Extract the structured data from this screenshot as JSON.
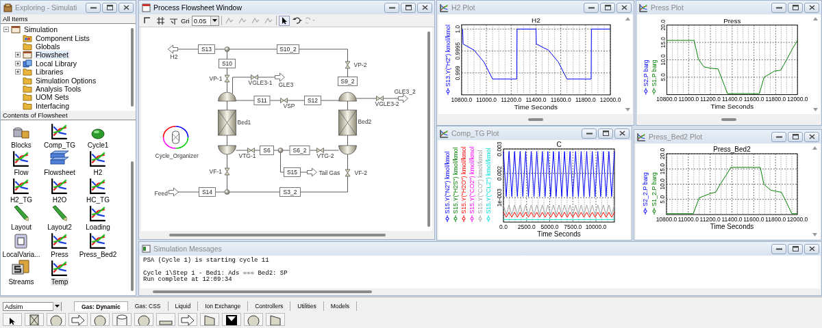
{
  "explorer": {
    "title": "Exploring - Simulati",
    "active": false,
    "tree_header": "All Items",
    "tree": [
      {
        "label": "Simulation",
        "kind": "window",
        "expanded": true,
        "selected": false,
        "children": [
          {
            "label": "Component Lists",
            "kind": "components",
            "selected": false
          },
          {
            "label": "Globals",
            "kind": "folder",
            "selected": false
          },
          {
            "label": "Flowsheet",
            "kind": "window",
            "expanded": false,
            "selected": true
          },
          {
            "label": "Local Library",
            "kind": "library",
            "expanded": false,
            "selected": false
          },
          {
            "label": "Libraries",
            "kind": "folder",
            "expanded": false,
            "selected": false
          },
          {
            "label": "Simulation Options",
            "kind": "folder",
            "selected": false
          },
          {
            "label": "Analysis Tools",
            "kind": "folder",
            "selected": false
          },
          {
            "label": "UOM Sets",
            "kind": "folder",
            "selected": false
          },
          {
            "label": "Interfacing",
            "kind": "folder",
            "selected": false
          }
        ]
      }
    ],
    "contents_header": "Contents of Flowsheet",
    "contents": [
      {
        "label": "Blocks",
        "kind": "blocks",
        "selected": false
      },
      {
        "label": "Comp_TG",
        "kind": "plot",
        "selected": false
      },
      {
        "label": "Cycle1",
        "kind": "cycle",
        "selected": false
      },
      {
        "label": "Flow",
        "kind": "plot",
        "selected": false
      },
      {
        "label": "Flowsheet",
        "kind": "flowsheet",
        "selected": false
      },
      {
        "label": "H2",
        "kind": "plot",
        "selected": false
      },
      {
        "label": "H2_TG",
        "kind": "plot",
        "selected": false
      },
      {
        "label": "H2O",
        "kind": "plot",
        "selected": false
      },
      {
        "label": "HC_TG",
        "kind": "plot",
        "selected": false
      },
      {
        "label": "Layout",
        "kind": "pencil",
        "selected": false
      },
      {
        "label": "Layout2",
        "kind": "pencil",
        "selected": false
      },
      {
        "label": "Loading",
        "kind": "plot",
        "selected": false
      },
      {
        "label": "LocalVaria...",
        "kind": "form",
        "selected": false
      },
      {
        "label": "Press",
        "kind": "plot",
        "selected": false
      },
      {
        "label": "Press_Bed2",
        "kind": "plot",
        "selected": false
      },
      {
        "label": "Streams",
        "kind": "streams",
        "selected": false
      },
      {
        "label": "Temp",
        "kind": "plot",
        "selected": true
      }
    ]
  },
  "flowsheet": {
    "title": "Process Flowsheet Window",
    "active": true,
    "grid_label": "Gri",
    "grid_value": "0.05",
    "stream_labels": [
      "S13",
      "S10_2",
      "S10",
      "S11",
      "S12",
      "S9_2",
      "S6",
      "S6_2",
      "S15",
      "S14",
      "S3_2"
    ],
    "unit_labels": [
      "H2",
      "VP-1",
      "VGLE3-1",
      "GLE3",
      "VP-2",
      "GLE3_2",
      "VGLE3-2",
      "VSP",
      "Bed1",
      "Bed2",
      "Cycle_Organizer",
      "VTG-1",
      "VTG-2",
      "VF-1",
      "Tail Gas",
      "VF-2",
      "Feed"
    ]
  },
  "h2_plot": {
    "title": "H2 Plot",
    "active": false,
    "chart_data": {
      "type": "line",
      "title": "H2",
      "xlabel": "Time Seconds",
      "x": [
        10808,
        10812,
        10900,
        10980,
        11050,
        11245,
        11247,
        11400,
        11403,
        11500,
        11580,
        11650,
        11845,
        11847,
        12000
      ],
      "series": [
        {
          "name": "S13.Y(\"H2\") kmol/kmol",
          "color": "#0000ff",
          "values": [
            1.0,
            0.99966,
            0.99952,
            0.99925,
            0.99886,
            0.99886,
            1.0,
            1.0,
            0.99966,
            0.99952,
            0.99925,
            0.99886,
            0.99886,
            1.0,
            1.0
          ]
        }
      ],
      "xlim": [
        10800,
        12000
      ],
      "ylim": [
        0.9985,
        1.0001
      ],
      "grid": true,
      "xticks": [
        {
          "value": 10800,
          "label": "10800.0"
        },
        {
          "value": 11000,
          "label": "11000.0"
        },
        {
          "value": 11200,
          "label": "11200.0"
        },
        {
          "value": 11400,
          "label": "11400.0"
        },
        {
          "value": 11600,
          "label": "11600.0"
        },
        {
          "value": 11800,
          "label": "11800.0"
        },
        {
          "value": 12000,
          "label": "12000.0"
        }
      ],
      "yticks": [
        {
          "value": 0.999,
          "label": "0.999"
        },
        {
          "value": 0.9995,
          "label": "0.9995"
        },
        {
          "value": 1.0,
          "label": "1.0"
        }
      ]
    }
  },
  "press_plot": {
    "title": "Press Plot",
    "active": false,
    "chart_data": {
      "type": "line",
      "title": "Press",
      "xlabel": "Time Seconds",
      "x": [
        10800,
        11050,
        11090,
        11140,
        11200,
        11270,
        11300,
        11357,
        11650,
        11693,
        11790,
        11845,
        11900,
        11950,
        12000
      ],
      "series": [
        {
          "name": "S2.P barg",
          "color": "#0000ff",
          "values": [
            null,
            null,
            null,
            null,
            null,
            null,
            null,
            null,
            null,
            null,
            null,
            null,
            null,
            null,
            null
          ]
        },
        {
          "name": "S1.P barg",
          "color": "#008000",
          "values": [
            15.6,
            15.6,
            10.2,
            8.0,
            7.6,
            7.4,
            5.0,
            0.3,
            0.3,
            5.0,
            6.8,
            7.0,
            10.0,
            13.0,
            15.6
          ]
        }
      ],
      "xlim": [
        10800,
        12000
      ],
      "ylim": [
        0,
        20
      ],
      "grid": true,
      "xticks": [
        {
          "value": 10800,
          "label": "10800.0"
        },
        {
          "value": 11000,
          "label": "11000.0"
        },
        {
          "value": 11200,
          "label": "11200.0"
        },
        {
          "value": 11400,
          "label": "11400.0"
        },
        {
          "value": 11600,
          "label": "11600.0"
        },
        {
          "value": 11800,
          "label": "11800.0"
        },
        {
          "value": 12000,
          "label": "12000.0"
        }
      ],
      "yticks": [
        {
          "value": 5,
          "label": "5.0"
        },
        {
          "value": 10,
          "label": "10.0"
        },
        {
          "value": 15,
          "label": "15.0"
        },
        {
          "value": 20,
          "label": "20.0"
        }
      ]
    }
  },
  "comp_tg_plot": {
    "title": "Comp_TG Plot",
    "active": false,
    "chart_data": {
      "type": "line",
      "title": "C",
      "xlabel": "Time Seconds",
      "x": [
        0,
        300,
        600,
        900,
        1200,
        1500,
        1800,
        2100,
        2400,
        2700,
        3000,
        3300,
        3600,
        3900,
        4200,
        4500,
        4800,
        5100,
        5400,
        5700,
        6000,
        6300,
        6600,
        6900,
        7200,
        7500,
        7800,
        8100,
        8400,
        8700,
        9000,
        9300,
        9600,
        9900,
        10200,
        10500,
        10800,
        11100,
        11400,
        11700,
        12000
      ],
      "series": [
        {
          "name": "S15.Y(\"N2\") kmol/kmol",
          "color": "#0000ff",
          "values": [
            0.0029,
            0.00105,
            0.0029,
            0.00105,
            0.0029,
            0.00105,
            0.0029,
            0.00105,
            0.0029,
            0.00105,
            0.0029,
            0.00105,
            0.0029,
            0.00105,
            0.0029,
            0.00105,
            0.0029,
            0.00105,
            0.0029,
            0.00105,
            0.0029,
            0.00105,
            0.0029,
            0.00105,
            0.0029,
            0.00105,
            0.0029,
            0.00105,
            0.0029,
            0.00105,
            0.0029,
            0.00105,
            0.0029,
            0.00105,
            0.0029,
            0.00105,
            0.0029,
            0.00105,
            0.0029,
            0.00105,
            0.0029
          ]
        },
        {
          "name": "S15.Y(\"H2S\") kmol/kmol",
          "color": "#008000",
          "values": [
            null,
            null,
            null,
            null,
            null,
            null,
            null,
            null,
            null,
            null,
            null,
            null,
            null,
            null,
            null,
            null,
            null,
            null,
            null,
            null,
            null,
            null,
            null,
            null,
            null,
            null,
            null,
            null,
            null,
            null,
            null,
            null,
            null,
            null,
            null,
            null,
            null,
            null,
            null,
            null,
            null
          ]
        },
        {
          "name": "S15.Y(\"H2O\") kmol/kmol",
          "color": "#ff0000",
          "values": [
            0.0004,
            0.0002,
            0.0004,
            0.0002,
            0.0004,
            0.0002,
            0.0004,
            0.0002,
            0.0004,
            0.0002,
            0.0004,
            0.0002,
            0.0004,
            0.0002,
            0.0004,
            0.0002,
            0.0004,
            0.0002,
            0.0004,
            0.0002,
            0.0004,
            0.0002,
            0.0004,
            0.0002,
            0.0004,
            0.0002,
            0.0004,
            0.0002,
            0.0004,
            0.0002,
            0.0004,
            0.0002,
            0.0004,
            0.0002,
            0.0004,
            0.0002,
            0.0004,
            0.0002,
            0.0004,
            0.0002,
            0.0004
          ]
        },
        {
          "name": "S15.Y(\"CO2\") kmol/kmol",
          "color": "#ff00ff",
          "values": [
            null,
            null,
            null,
            null,
            null,
            null,
            null,
            null,
            null,
            null,
            null,
            null,
            null,
            null,
            null,
            null,
            null,
            null,
            null,
            null,
            null,
            null,
            null,
            null,
            null,
            null,
            null,
            null,
            null,
            null,
            null,
            null,
            null,
            null,
            null,
            null,
            null,
            null,
            null,
            null,
            null
          ]
        },
        {
          "name": "S15.Y(\"CO\") kmol/kmol",
          "color": "#a0a0a0",
          "values": [
            0.0007,
            0.0003,
            0.0007,
            0.0003,
            0.0007,
            0.0003,
            0.0007,
            0.0003,
            0.0007,
            0.0003,
            0.0007,
            0.0003,
            0.0007,
            0.0003,
            0.0007,
            0.0003,
            0.0007,
            0.0003,
            0.0007,
            0.0003,
            0.0007,
            0.0003,
            0.0007,
            0.0003,
            0.0007,
            0.0003,
            0.0007,
            0.0003,
            0.0007,
            0.0003,
            0.0007,
            0.0003,
            0.0007,
            0.0003,
            0.0007,
            0.0003,
            0.0007,
            0.0003,
            0.0007,
            0.0003,
            0.0007
          ]
        },
        {
          "name": "S15.Y(\"CL2\") kmol/kmol",
          "color": "#00e0e0",
          "values": [
            0.0001,
            0.0001,
            0.0001,
            0.0001,
            0.0001,
            0.0001,
            0.0001,
            0.0001,
            0.0001,
            0.0001,
            0.0001,
            0.0001,
            0.0001,
            0.0001,
            0.0001,
            0.0001,
            0.0001,
            0.0001,
            0.0001,
            0.0001,
            0.0001,
            0.0001,
            0.0001,
            0.0001,
            0.0001,
            0.0001,
            0.0001,
            0.0001,
            0.0001,
            0.0001,
            0.0001,
            0.0001,
            0.0001,
            0.0001,
            0.0001,
            0.0001,
            0.0001,
            0.0001,
            0.0001,
            0.0001,
            0.0001
          ]
        }
      ],
      "xlim": [
        0,
        12000
      ],
      "ylim": [
        0,
        0.003
      ],
      "grid": true,
      "xticks": [
        {
          "value": 0,
          "label": "0.0"
        },
        {
          "value": 2500,
          "label": "2500.0"
        },
        {
          "value": 5000,
          "label": "5000.0"
        },
        {
          "value": 7500,
          "label": "7500.0"
        },
        {
          "value": 10000,
          "label": "10000.0"
        }
      ],
      "yticks": [
        {
          "value": 0.001,
          "label": "1e-003"
        },
        {
          "value": 0.002,
          "label": "0.002"
        },
        {
          "value": 0.003,
          "label": "0.003"
        }
      ]
    }
  },
  "press_bed2_plot": {
    "title": "Press_Bed2 Plot",
    "active": false,
    "chart_data": {
      "type": "line",
      "title": "Press_Bed2",
      "xlabel": "Time Seconds",
      "x": [
        10800,
        11045,
        11100,
        11208,
        11250,
        11293,
        11348,
        11390,
        11660,
        11693,
        11757,
        11855,
        11900,
        11950,
        12000
      ],
      "series": [
        {
          "name": "S2_2.P barg",
          "color": "#0000ff",
          "values": [
            null,
            null,
            null,
            null,
            null,
            null,
            null,
            null,
            null,
            null,
            null,
            null,
            null,
            null,
            null
          ]
        },
        {
          "name": "S1_2.P barg",
          "color": "#008000",
          "values": [
            0.3,
            0.3,
            5.5,
            7.0,
            7.3,
            10.0,
            13.0,
            15.5,
            15.5,
            10.0,
            8.0,
            7.3,
            4.0,
            0.3,
            0.3
          ]
        }
      ],
      "xlim": [
        10800,
        12000
      ],
      "ylim": [
        0,
        20
      ],
      "grid": true,
      "xticks": [
        {
          "value": 10800,
          "label": "10800.0"
        },
        {
          "value": 11000,
          "label": "11000.0"
        },
        {
          "value": 11200,
          "label": "11200.0"
        },
        {
          "value": 11400,
          "label": "11400.0"
        },
        {
          "value": 11600,
          "label": "11600.0"
        },
        {
          "value": 11800,
          "label": "11800.0"
        },
        {
          "value": 12000,
          "label": "12000.0"
        }
      ],
      "yticks": [
        {
          "value": 5,
          "label": "5.0"
        },
        {
          "value": 10,
          "label": "10.0"
        },
        {
          "value": 15,
          "label": "15.0"
        },
        {
          "value": 20,
          "label": "20.0"
        }
      ]
    }
  },
  "messages": {
    "title": "Simulation Messages",
    "active": false,
    "blocks": [
      [
        "PSA (Cycle 1) is starting cycle 11"
      ],
      [
        "Cycle 1\\Step 1 - Bed1: Ads === Bed2: SP",
        "Run complete at 12:09:34"
      ]
    ]
  },
  "palette": {
    "library": "Adsim",
    "tabs": [
      {
        "label": "Gas: Dynamic",
        "selected": true
      },
      {
        "label": "Gas: CSS",
        "selected": false
      },
      {
        "label": "Liquid",
        "selected": false
      },
      {
        "label": "Ion Exchange",
        "selected": false
      },
      {
        "label": "Controllers",
        "selected": false
      },
      {
        "label": "Utilities",
        "selected": false
      },
      {
        "label": "Models",
        "selected": false
      }
    ]
  }
}
